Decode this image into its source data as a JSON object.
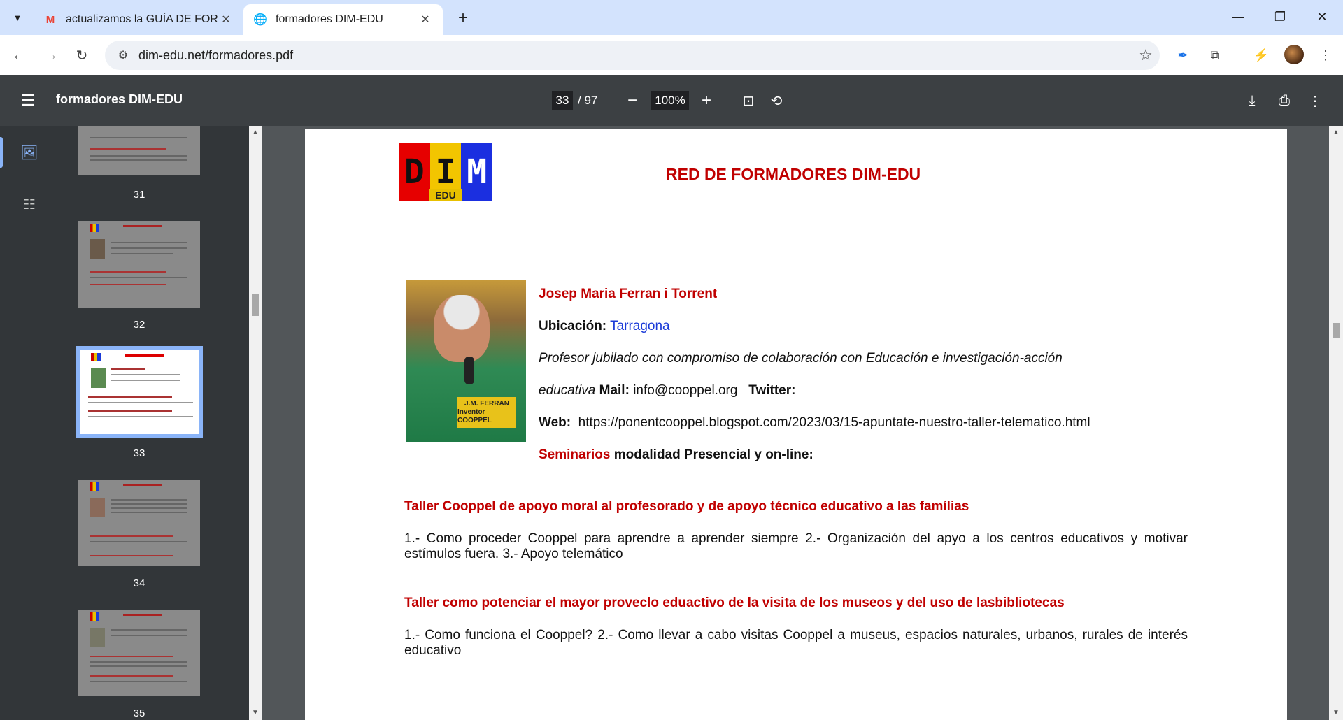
{
  "tabs": [
    {
      "title": "actualizamos la GUÍA DE FORM",
      "favicon": "M",
      "favicon_color": "#ea4335"
    },
    {
      "title": "formadores DIM-EDU",
      "favicon": "🌐"
    }
  ],
  "address": {
    "url": "dim-edu.net/formadores.pdf"
  },
  "pdf_toolbar": {
    "title": "formadores DIM-EDU",
    "current_page": "33",
    "total_pages": "/ 97",
    "zoom": "100%"
  },
  "thumbnails": [
    {
      "label": "31"
    },
    {
      "label": "32"
    },
    {
      "label": "33"
    },
    {
      "label": "34"
    },
    {
      "label": "35"
    }
  ],
  "page": {
    "logo": {
      "d": "D",
      "i": "I",
      "m": "M",
      "edu": "EDU"
    },
    "heading": "RED DE FORMADORES DIM-EDU",
    "photo_plate": [
      "J.M. FERRAN",
      "Inventor COOPPEL"
    ],
    "name": "Josep Maria Ferran i Torrent",
    "location_label": "Ubicación:",
    "location_value": "Tarragona",
    "bio_line1": "Profesor jubilado con compromiso de colaboración con Educación e investigación-acción",
    "bio_line2": "educativa",
    "mail_label": "Mail:",
    "mail_value": "info@cooppel.org",
    "twitter_label": "Twitter:",
    "web_label": "Web:",
    "web_value": "https://ponentcooppel.blogspot.com/2023/03/15-apuntate-nuestro-taller-telematico.html",
    "seminars_label": "Seminarios",
    "seminars_mode": "modalidad Presencial y on-line:",
    "workshop1_title": "Taller Cooppel de apoyo moral al profesorado y de apoyo técnico educativo a las famílias",
    "workshop1_body": "1.- Como proceder Cooppel para aprendre a aprender siempre 2.- Organización del apyo a los centros educativos y motivar estímulos fuera. 3.- Apoyo telemático",
    "workshop2_title": "Taller como potenciar el mayor proveclo eduactivo de la visita de los museos y del uso de lasbibliotecas",
    "workshop2_body": "1.- Como funciona el Cooppel? 2.- Como llevar a cabo visitas Cooppel a museus, espacios naturales, urbanos, rurales de interés educativo"
  }
}
